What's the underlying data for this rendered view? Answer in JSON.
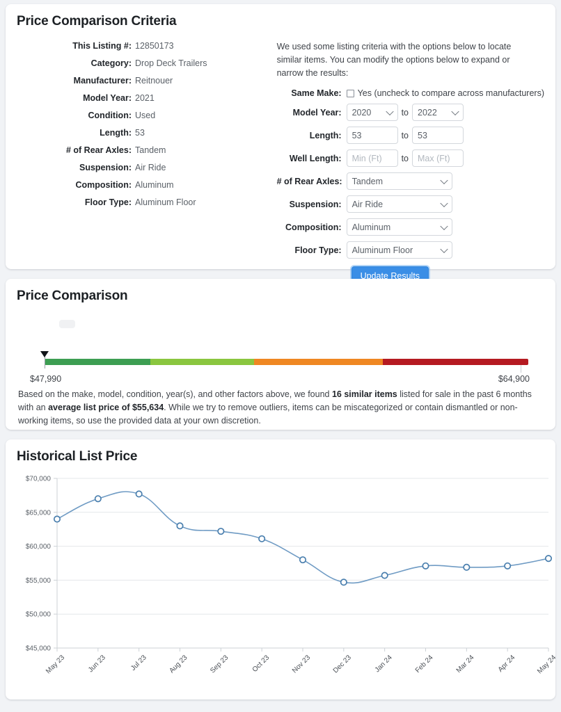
{
  "criteria": {
    "title": "Price Comparison Criteria",
    "rows": [
      {
        "label": "This Listing #:",
        "value": "12850173"
      },
      {
        "label": "Category:",
        "value": "Drop Deck Trailers"
      },
      {
        "label": "Manufacturer:",
        "value": "Reitnouer"
      },
      {
        "label": "Model Year:",
        "value": "2021"
      },
      {
        "label": "Condition:",
        "value": "Used"
      },
      {
        "label": "Length:",
        "value": "53"
      },
      {
        "label": "# of Rear Axles:",
        "value": "Tandem"
      },
      {
        "label": "Suspension:",
        "value": "Air Ride"
      },
      {
        "label": "Composition:",
        "value": "Aluminum"
      },
      {
        "label": "Floor Type:",
        "value": "Aluminum Floor"
      }
    ],
    "intro": "We used some listing criteria with the options below to locate similar items. You can modify the options below to expand or narrow the results:",
    "form": {
      "same_make_label": "Same Make:",
      "same_make_text": "Yes (uncheck to compare across manufacturers)",
      "same_make_checked": false,
      "model_year_label": "Model Year:",
      "model_year_from": "2020",
      "model_year_to": "2022",
      "length_label": "Length:",
      "length_from": "53",
      "length_to": "53",
      "well_length_label": "Well Length:",
      "well_length_from": "",
      "well_length_from_placeholder": "Min (Ft)",
      "well_length_to": "",
      "well_length_to_placeholder": "Max (Ft)",
      "rear_axles_label": "# of Rear Axles:",
      "rear_axles_value": "Tandem",
      "suspension_label": "Suspension:",
      "suspension_value": "Air Ride",
      "composition_label": "Composition:",
      "composition_value": "Aluminum",
      "floor_type_label": "Floor Type:",
      "floor_type_value": "Aluminum Floor",
      "to_label": "to",
      "update_button": "Update Results"
    }
  },
  "comparison": {
    "title": "Price Comparison",
    "range_min_label": "$47,990",
    "range_max_label": "$64,900",
    "marker_percent": 0,
    "segments": [
      {
        "name": "green",
        "color": "#3d9e52",
        "percent": 21.8
      },
      {
        "name": "light-green",
        "color": "#8ac63f",
        "percent": 21.5
      },
      {
        "name": "orange",
        "color": "#ef8722",
        "percent": 26.7
      },
      {
        "name": "red",
        "color": "#b51a21",
        "percent": 30.0
      }
    ],
    "summary_parts": [
      {
        "text": "Based on the make, model, condition, year(s), and other factors above, we found ",
        "bold": false
      },
      {
        "text": "16 similar items",
        "bold": true
      },
      {
        "text": " listed for sale in the past 6 months with an ",
        "bold": false
      },
      {
        "text": "average list price of $55,634",
        "bold": true
      },
      {
        "text": ". While we try to remove outliers, items can be miscategorized or contain dismantled or non-working items, so use the provided data at your own discretion.",
        "bold": false
      }
    ]
  },
  "chart_data": {
    "type": "line",
    "title": "Historical List Price",
    "xlabel": "",
    "ylabel": "",
    "ylim": [
      45000,
      70000
    ],
    "ytick_values": [
      70000,
      65000,
      60000,
      55000,
      50000,
      45000
    ],
    "ytick_labels": [
      "$70,000",
      "$65,000",
      "$60,000",
      "$55,000",
      "$50,000",
      "$45,000"
    ],
    "grid": true,
    "legend": "none",
    "categories": [
      "May 23",
      "Jun 23",
      "Jul 23",
      "Aug 23",
      "Sep 23",
      "Oct 23",
      "Nov 23",
      "Dec 23",
      "Jan 24",
      "Feb 24",
      "Mar 24",
      "Apr 24",
      "May 24"
    ],
    "series": [
      {
        "name": "Historical List Price",
        "color": "#6f9bc4",
        "values": [
          64000,
          67000,
          67700,
          63000,
          62200,
          61100,
          58000,
          54700,
          55700,
          57100,
          56900,
          57100,
          58200
        ]
      }
    ]
  }
}
